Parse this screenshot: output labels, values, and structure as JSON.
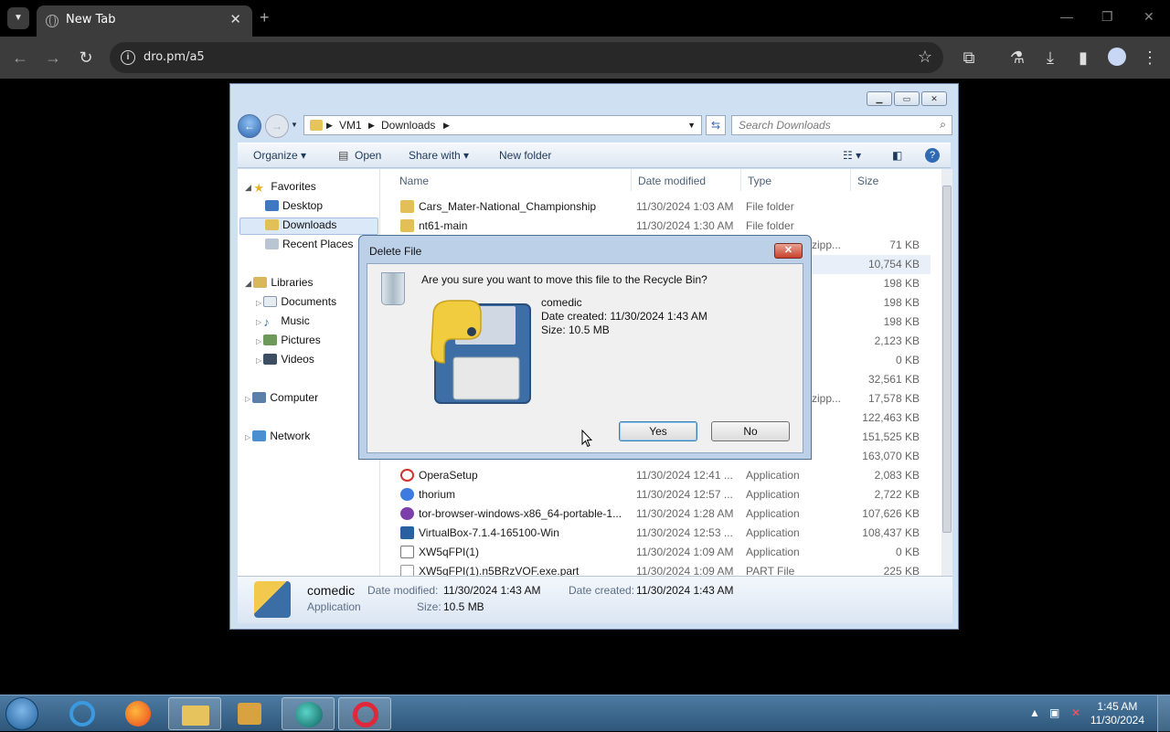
{
  "browser": {
    "tab_title": "New Tab",
    "url": "dro.pm/a5"
  },
  "explorer": {
    "breadcrumb": [
      "VM1",
      "Downloads"
    ],
    "search_placeholder": "Search Downloads",
    "commands": {
      "organize": "Organize ▾",
      "open": "Open",
      "share": "Share with ▾",
      "new_folder": "New folder"
    },
    "nav": {
      "favorites": "Favorites",
      "desktop": "Desktop",
      "downloads": "Downloads",
      "recent": "Recent Places",
      "libraries": "Libraries",
      "documents": "Documents",
      "music": "Music",
      "pictures": "Pictures",
      "videos": "Videos",
      "computer": "Computer",
      "network": "Network"
    },
    "columns": {
      "name": "Name",
      "date": "Date modified",
      "type": "Type",
      "size": "Size"
    },
    "rows_top": [
      {
        "name": "Cars_Mater-National_Championship",
        "date": "11/30/2024 1:03 AM",
        "type": "File folder",
        "size": ""
      },
      {
        "name": "nt61-main",
        "date": "11/30/2024 1:30 AM",
        "type": "File folder",
        "size": ""
      }
    ],
    "partial_rows": [
      {
        "type": "zipp...",
        "size": "71 KB"
      },
      {
        "type": "",
        "size": "10,754 KB"
      },
      {
        "type": "",
        "size": "198 KB"
      },
      {
        "type": "",
        "size": "198 KB"
      },
      {
        "type": "",
        "size": "198 KB"
      },
      {
        "type": "",
        "size": "2,123 KB"
      },
      {
        "type": "",
        "size": "0 KB"
      },
      {
        "type": "",
        "size": "32,561 KB"
      },
      {
        "type": "zipp...",
        "size": "17,578 KB"
      },
      {
        "type": "",
        "size": "122,463 KB"
      },
      {
        "type": "",
        "size": "151,525 KB"
      },
      {
        "type": "",
        "size": "163,070 KB"
      }
    ],
    "rows_bottom": [
      {
        "name": "OperaSetup",
        "date": "11/30/2024 12:41 ...",
        "type": "Application",
        "size": "2,083 KB"
      },
      {
        "name": "thorium",
        "date": "11/30/2024 12:57 ...",
        "type": "Application",
        "size": "2,722 KB"
      },
      {
        "name": "tor-browser-windows-x86_64-portable-1...",
        "date": "11/30/2024 1:28 AM",
        "type": "Application",
        "size": "107,626 KB"
      },
      {
        "name": "VirtualBox-7.1.4-165100-Win",
        "date": "11/30/2024 12:53 ...",
        "type": "Application",
        "size": "108,437 KB"
      },
      {
        "name": "XW5qFPI(1)",
        "date": "11/30/2024 1:09 AM",
        "type": "Application",
        "size": "0 KB"
      },
      {
        "name": "XW5qFPI(1).n5BRzVOF.exe.part",
        "date": "11/30/2024 1:09 AM",
        "type": "PART File",
        "size": "225 KB"
      }
    ],
    "details": {
      "name": "comedic",
      "kind": "Application",
      "modified_label": "Date modified:",
      "modified": "11/30/2024 1:43 AM",
      "created_label": "Date created:",
      "created": "11/30/2024 1:43 AM",
      "size_label": "Size:",
      "size": "10.5 MB"
    }
  },
  "dialog": {
    "title": "Delete File",
    "question": "Are you sure you want to move this file to the Recycle Bin?",
    "file_name": "comedic",
    "date_created": "Date created: 11/30/2024 1:43 AM",
    "size": "Size: 10.5 MB",
    "yes": "Yes",
    "no": "No"
  },
  "taskbar": {
    "time": "1:45 AM",
    "date": "11/30/2024"
  }
}
